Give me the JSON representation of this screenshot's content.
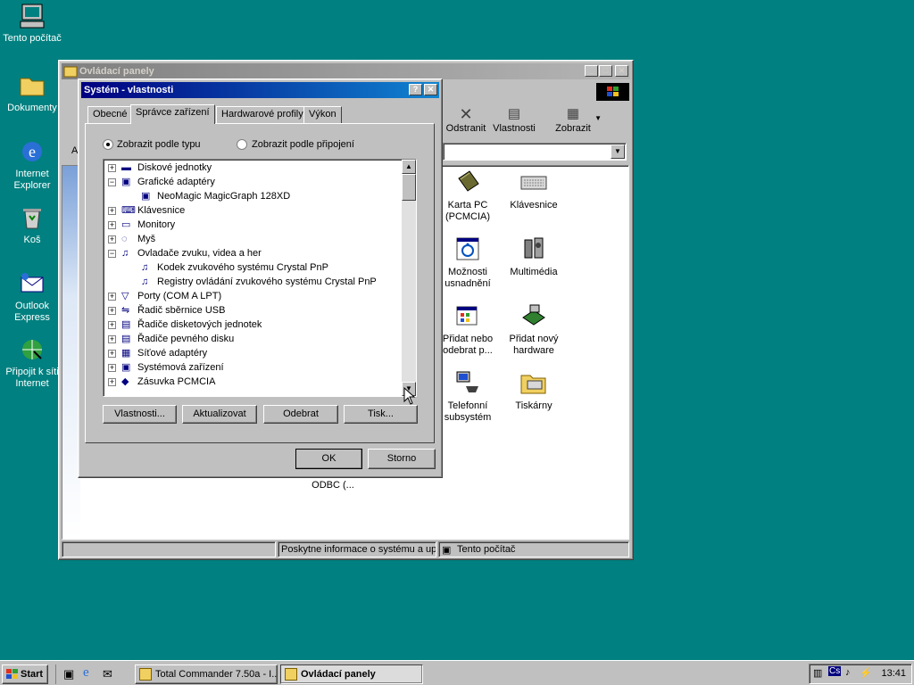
{
  "desktop": {
    "icons": [
      {
        "label": "Tento počítač",
        "icon": "computer-icon"
      },
      {
        "label": "Dokumenty",
        "icon": "folder-icon"
      },
      {
        "label": "Internet Explorer",
        "icon": "ie-icon"
      },
      {
        "label": "Koš",
        "icon": "recycle-bin-icon"
      },
      {
        "label": "Outlook Express",
        "icon": "outlook-icon"
      },
      {
        "label": "Připojit k síti Internet",
        "icon": "connect-icon"
      }
    ]
  },
  "control_panel": {
    "title": "Ovládací panely",
    "toolbar": {
      "delete": "Odstranit",
      "properties": "Vlastnosti",
      "view": "Zobrazit"
    },
    "address_label": "A",
    "items": [
      {
        "label": "Karta PC (PCMCIA)",
        "icon": "pcmcia-icon"
      },
      {
        "label": "Klávesnice",
        "icon": "keyboard-icon"
      },
      {
        "label": "Možnosti usnadnění",
        "icon": "accessibility-icon"
      },
      {
        "label": "Multimédia",
        "icon": "multimedia-icon"
      },
      {
        "label": "Přidat nebo odebrat p...",
        "icon": "add-remove-icon"
      },
      {
        "label": "Přidat nový hardware",
        "icon": "add-hardware-icon"
      },
      {
        "label": "Telefonní subsystém",
        "icon": "telephony-icon"
      },
      {
        "label": "Tiskárny",
        "icon": "printers-icon"
      }
    ],
    "partial_item": "ODBC (...",
    "status": {
      "left": "Poskytne informace o systému a upř",
      "right": "Tento počítač"
    }
  },
  "system_dialog": {
    "title": "Systém - vlastnosti",
    "help_btn": "?",
    "close_btn": "✕",
    "tabs": [
      "Obecné",
      "Správce zařízení",
      "Hardwarové profily",
      "Výkon"
    ],
    "active_tab": 1,
    "radio_by_type": "Zobrazit podle typu",
    "radio_by_connection": "Zobrazit podle připojení",
    "tree": [
      {
        "label": "Diskové jednotky",
        "level": 0,
        "state": "+",
        "icon": "disk-icon"
      },
      {
        "label": "Grafické adaptéry",
        "level": 0,
        "state": "-",
        "icon": "display-adapter-icon"
      },
      {
        "label": "NeoMagic MagicGraph 128XD",
        "level": 1,
        "state": "",
        "icon": "display-adapter-icon"
      },
      {
        "label": "Klávesnice",
        "level": 0,
        "state": "+",
        "icon": "keyboard-icon"
      },
      {
        "label": "Monitory",
        "level": 0,
        "state": "+",
        "icon": "monitor-icon"
      },
      {
        "label": "Myš",
        "level": 0,
        "state": "+",
        "icon": "mouse-icon"
      },
      {
        "label": "Ovladače zvuku, videa a her",
        "level": 0,
        "state": "-",
        "icon": "sound-icon"
      },
      {
        "label": "Kodek zvukového systému Crystal PnP",
        "level": 1,
        "state": "",
        "icon": "sound-icon"
      },
      {
        "label": "Registry ovládání zvukového systému Crystal PnP",
        "level": 1,
        "state": "",
        "icon": "sound-icon"
      },
      {
        "label": "Porty (COM A LPT)",
        "level": 0,
        "state": "+",
        "icon": "port-icon"
      },
      {
        "label": "Řadič sběrnice USB",
        "level": 0,
        "state": "+",
        "icon": "usb-icon"
      },
      {
        "label": "Řadiče disketových jednotek",
        "level": 0,
        "state": "+",
        "icon": "floppy-controller-icon"
      },
      {
        "label": "Řadiče pevného disku",
        "level": 0,
        "state": "+",
        "icon": "hdd-controller-icon"
      },
      {
        "label": "Síťové adaptéry",
        "level": 0,
        "state": "+",
        "icon": "network-adapter-icon"
      },
      {
        "label": "Systémová zařízení",
        "level": 0,
        "state": "+",
        "icon": "system-device-icon"
      },
      {
        "label": "Zásuvka PCMCIA",
        "level": 0,
        "state": "+",
        "icon": "pcmcia-icon"
      }
    ],
    "buttons": {
      "properties": "Vlastnosti...",
      "refresh": "Aktualizovat",
      "remove": "Odebrat",
      "print": "Tisk..."
    },
    "ok": "OK",
    "cancel": "Storno"
  },
  "taskbar": {
    "start": "Start",
    "tasks": [
      {
        "label": "Total Commander 7.50a - I...",
        "active": false
      },
      {
        "label": "Ovládací panely",
        "active": true
      }
    ],
    "clock": "13:41"
  },
  "colors": {
    "desktop": "#008080",
    "active_title": "#000080",
    "face": "#c0c0c0"
  }
}
